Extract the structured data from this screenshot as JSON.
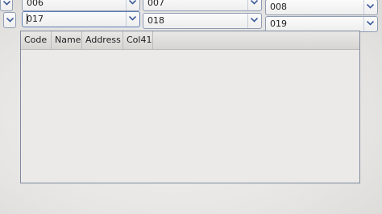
{
  "combos_row1": [
    {
      "value": "006"
    },
    {
      "value": "007"
    },
    {
      "value": "008"
    }
  ],
  "combos_row2": [
    {
      "value": "017"
    },
    {
      "value": "018"
    },
    {
      "value": "019"
    }
  ],
  "grid": {
    "columns": [
      "Code",
      "Name",
      "Address",
      "Col41"
    ]
  },
  "colors": {
    "combo_border": "#8f9cb4",
    "arrow_color": "#3a5a9a",
    "grid_border": "#7f8a9c"
  }
}
